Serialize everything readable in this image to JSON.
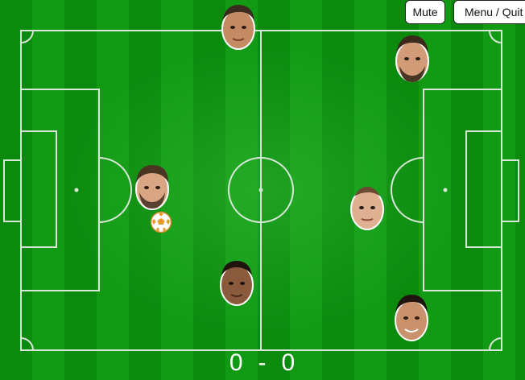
{
  "buttons": {
    "mute": "Mute",
    "menu_quit": "Menu / Quit"
  },
  "score": {
    "left": "0",
    "separator": "-",
    "right": "0"
  },
  "players": [
    {
      "team": "left",
      "role": "striker-top"
    },
    {
      "team": "left",
      "role": "ball-carrier",
      "has_ball": true
    },
    {
      "team": "left",
      "role": "striker-bottom"
    },
    {
      "team": "right",
      "role": "defender-top"
    },
    {
      "team": "right",
      "role": "midfielder"
    },
    {
      "team": "right",
      "role": "defender-bottom"
    }
  ],
  "colors": {
    "pitch_dark": "#0b8a0e",
    "pitch_light": "#129a15",
    "line": "#d8e8d8",
    "score_text": "#ffffff"
  }
}
